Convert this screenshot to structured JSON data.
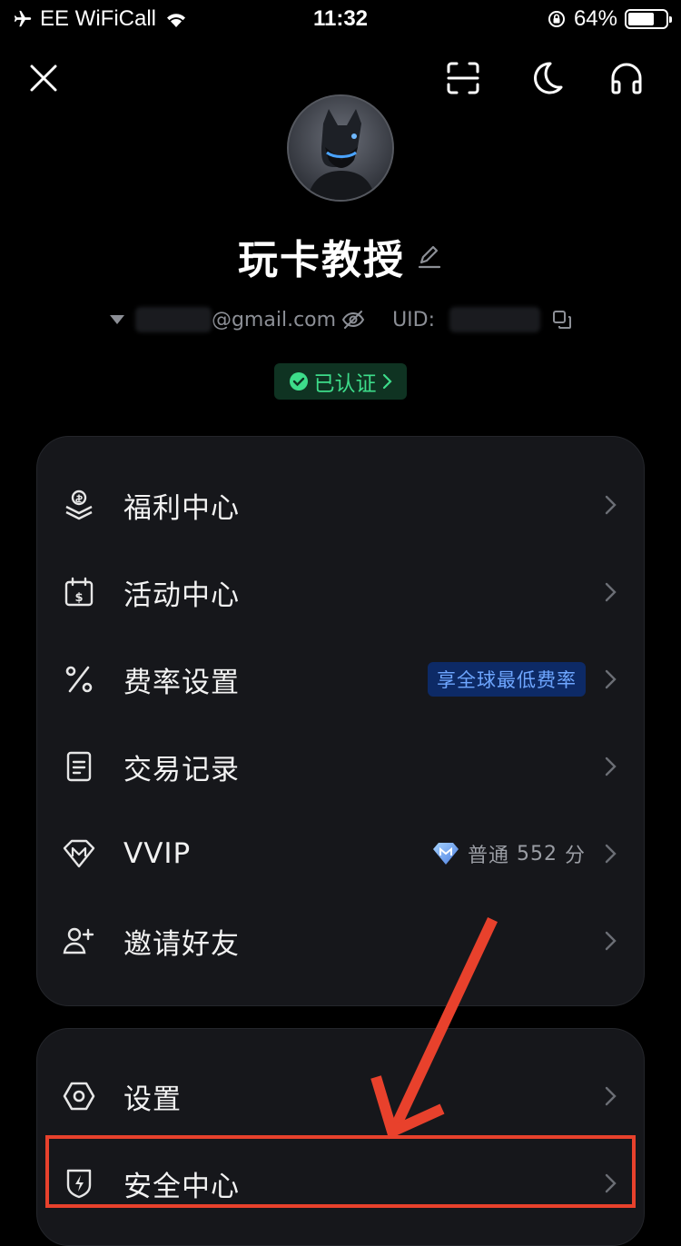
{
  "status": {
    "carrier": "EE WiFiCall",
    "time": "11:32",
    "battery": "64%"
  },
  "profile": {
    "username": "玩卡教授",
    "email_suffix": "@gmail.com",
    "uid_label": "UID:",
    "verified_label": "已认证"
  },
  "menu_main": [
    {
      "label": "福利中心"
    },
    {
      "label": "活动中心"
    },
    {
      "label": "费率设置",
      "badge": "享全球最低费率"
    },
    {
      "label": "交易记录"
    },
    {
      "label": "VVIP",
      "level": "普通",
      "points": "552",
      "points_unit": "分"
    },
    {
      "label": "邀请好友"
    }
  ],
  "menu_secondary": [
    {
      "label": "设置"
    },
    {
      "label": "安全中心"
    }
  ],
  "colors": {
    "accent_green": "#3ddc8a",
    "badge_blue": "#6ea6ff",
    "annotation_red": "#e8412c"
  }
}
